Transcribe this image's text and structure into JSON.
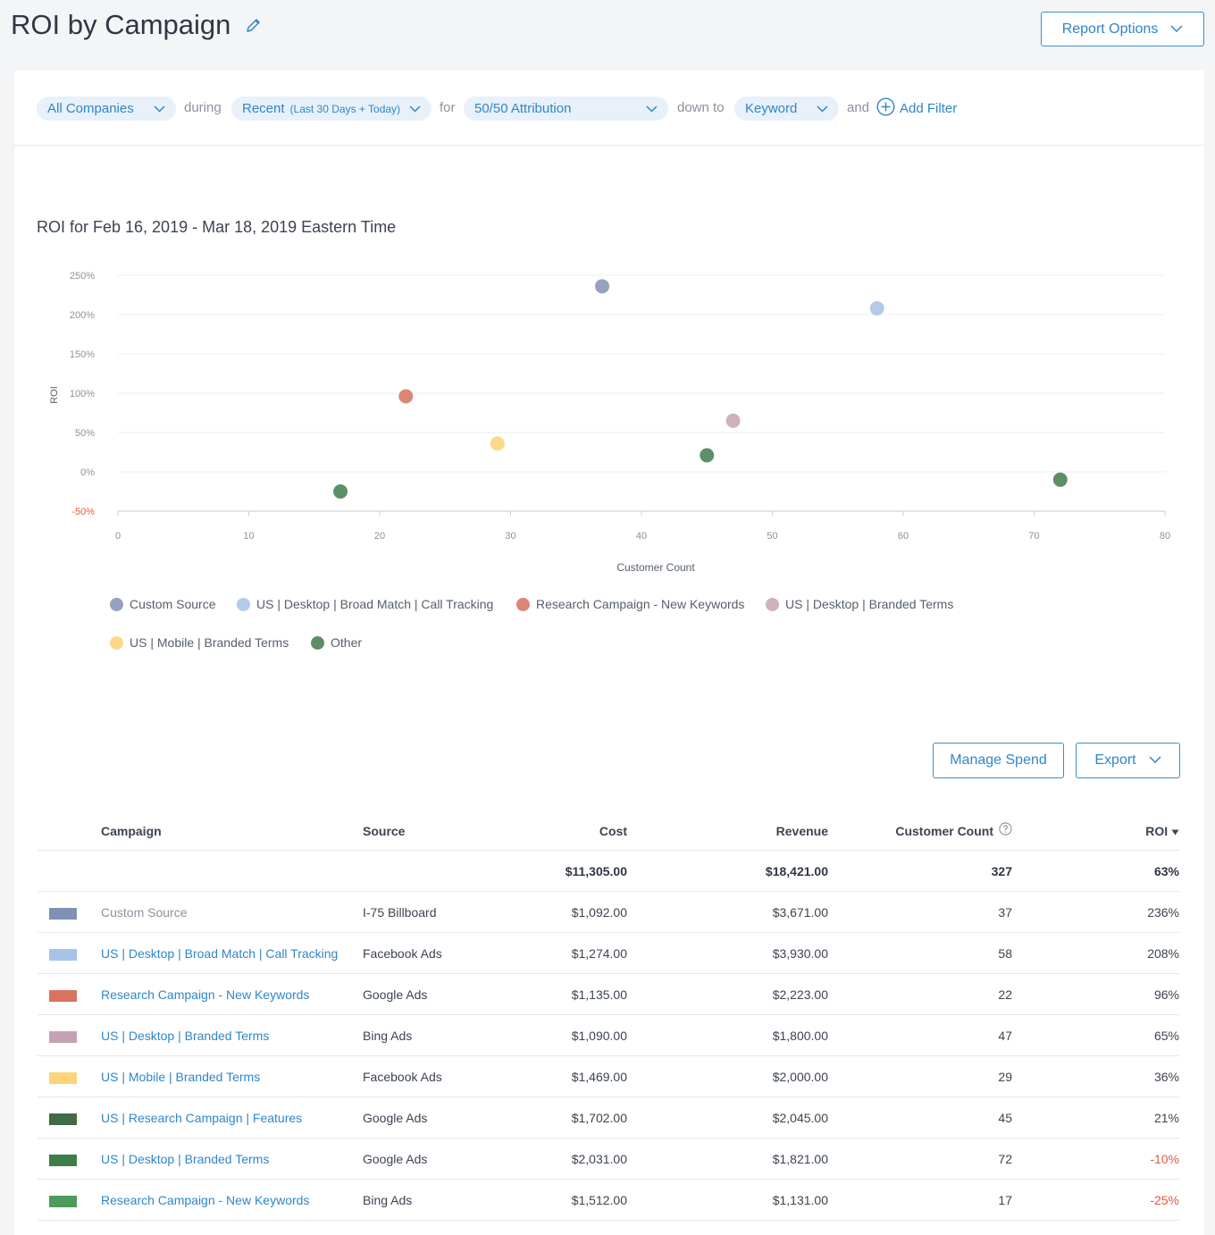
{
  "header": {
    "title": "ROI by Campaign",
    "report_options_label": "Report Options"
  },
  "filters": {
    "company": "All Companies",
    "during_label": "during",
    "period_main": "Recent",
    "period_detail": "(Last 30 Days + Today)",
    "for_label": "for",
    "attribution": "50/50 Attribution",
    "down_to_label": "down to",
    "level": "Keyword",
    "and_label": "and",
    "add_filter": "Add Filter"
  },
  "chart_data": {
    "type": "scatter",
    "title": "ROI for Feb 16, 2019 - Mar 18, 2019 Eastern Time",
    "xlabel": "Customer Count",
    "ylabel": "ROI",
    "xlim": [
      0,
      80
    ],
    "ylim": [
      -50,
      250
    ],
    "x_ticks": [
      "0",
      "10",
      "20",
      "30",
      "40",
      "50",
      "60",
      "70",
      "80"
    ],
    "y_ticks": [
      "250%",
      "200%",
      "150%",
      "100%",
      "50%",
      "0%",
      "-50%"
    ],
    "grid": true,
    "series": [
      {
        "name": "Custom Source",
        "color": "#94a2bf",
        "points": [
          {
            "x": 37,
            "y": 236
          }
        ]
      },
      {
        "name": "US | Desktop | Broad Match | Call Tracking",
        "color": "#b3cbe9",
        "points": [
          {
            "x": 58,
            "y": 208
          }
        ]
      },
      {
        "name": "Research Campaign - New Keywords",
        "color": "#dc8677",
        "points": [
          {
            "x": 22,
            "y": 96
          }
        ]
      },
      {
        "name": "US | Desktop | Branded Terms",
        "color": "#cfb1c0",
        "points": [
          {
            "x": 47,
            "y": 65
          }
        ]
      },
      {
        "name": "US | Mobile | Branded Terms",
        "color": "#fbd986",
        "points": [
          {
            "x": 29,
            "y": 36
          }
        ]
      },
      {
        "name": "Other",
        "color": "#5d8f66",
        "points": [
          {
            "x": 45,
            "y": 21
          },
          {
            "x": 72,
            "y": -10
          },
          {
            "x": 17,
            "y": -25
          }
        ]
      }
    ]
  },
  "legend_rows": [
    [
      {
        "name": "Custom Source",
        "color": "#94a2bf"
      },
      {
        "name": "US | Desktop | Broad Match | Call Tracking",
        "color": "#b3cbe9"
      },
      {
        "name": "Research Campaign - New Keywords",
        "color": "#dc8677"
      },
      {
        "name": "US | Desktop | Branded Terms",
        "color": "#cfb1c0"
      }
    ],
    [
      {
        "name": "US | Mobile | Branded Terms",
        "color": "#fbd986"
      },
      {
        "name": "Other",
        "color": "#5d8f66"
      }
    ]
  ],
  "actions": {
    "manage_spend": "Manage Spend",
    "export": "Export"
  },
  "table": {
    "headers": {
      "campaign": "Campaign",
      "source": "Source",
      "cost": "Cost",
      "revenue": "Revenue",
      "customer_count": "Customer Count",
      "roi": "ROI"
    },
    "totals": {
      "cost": "$11,305.00",
      "revenue": "$18,421.00",
      "customer_count": "327",
      "roi": "63%"
    },
    "rows": [
      {
        "color": "#7f90b5",
        "campaign": "Custom Source",
        "source": "I-75 Billboard",
        "cost": "$1,092.00",
        "revenue": "$3,671.00",
        "customer_count": "37",
        "roi": "236%"
      },
      {
        "color": "#a7c3e8",
        "campaign": "US | Desktop | Broad Match | Call Tracking",
        "source": "Facebook Ads",
        "cost": "$1,274.00",
        "revenue": "$3,930.00",
        "customer_count": "58",
        "roi": "208%"
      },
      {
        "color": "#d9735f",
        "campaign": "Research Campaign - New Keywords",
        "source": "Google Ads",
        "cost": "$1,135.00",
        "revenue": "$2,223.00",
        "customer_count": "22",
        "roi": "96%"
      },
      {
        "color": "#c4a2b3",
        "campaign": "US | Desktop | Branded Terms",
        "source": "Bing Ads",
        "cost": "$1,090.00",
        "revenue": "$1,800.00",
        "customer_count": "47",
        "roi": "65%"
      },
      {
        "color": "#fbd37a",
        "campaign": "US | Mobile | Branded Terms",
        "source": "Facebook Ads",
        "cost": "$1,469.00",
        "revenue": "$2,000.00",
        "customer_count": "29",
        "roi": "36%"
      },
      {
        "color": "#3f6b47",
        "campaign": "US | Research Campaign | Features",
        "source": "Google Ads",
        "cost": "$1,702.00",
        "revenue": "$2,045.00",
        "customer_count": "45",
        "roi": "21%"
      },
      {
        "color": "#3c7e48",
        "campaign": "US | Desktop | Branded Terms",
        "source": "Google Ads",
        "cost": "$2,031.00",
        "revenue": "$1,821.00",
        "customer_count": "72",
        "roi": "-10%"
      },
      {
        "color": "#4f9a5b",
        "campaign": "Research Campaign - New Keywords",
        "source": "Bing Ads",
        "cost": "$1,512.00",
        "revenue": "$1,131.00",
        "customer_count": "17",
        "roi": "-25%"
      }
    ]
  }
}
